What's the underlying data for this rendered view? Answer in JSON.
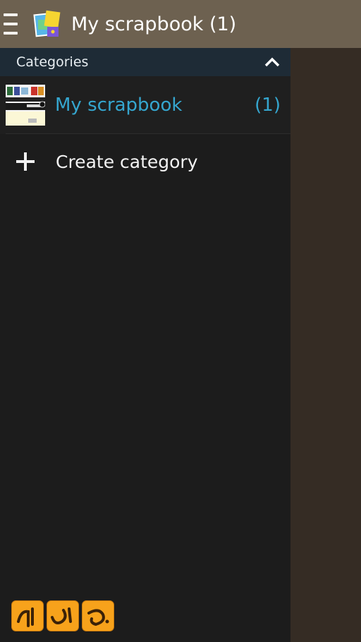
{
  "appbar": {
    "menu_icon": "menu-icon",
    "app_icon": "scrapbook-app-icon",
    "title": "My scrapbook (1)"
  },
  "drawer": {
    "header": {
      "label": "Categories",
      "collapse_icon": "chevron-up-icon"
    },
    "categories": [
      {
        "name": "My scrapbook",
        "count": "(1)"
      }
    ],
    "create": {
      "icon": "plus-icon",
      "label": "Create category"
    }
  },
  "colors": {
    "appbar": "#6d6150",
    "drawer_bg": "#1c1c1c",
    "drawer_header": "#1e2b36",
    "accent": "#35a6cf",
    "watermark": "#f7a21b"
  }
}
